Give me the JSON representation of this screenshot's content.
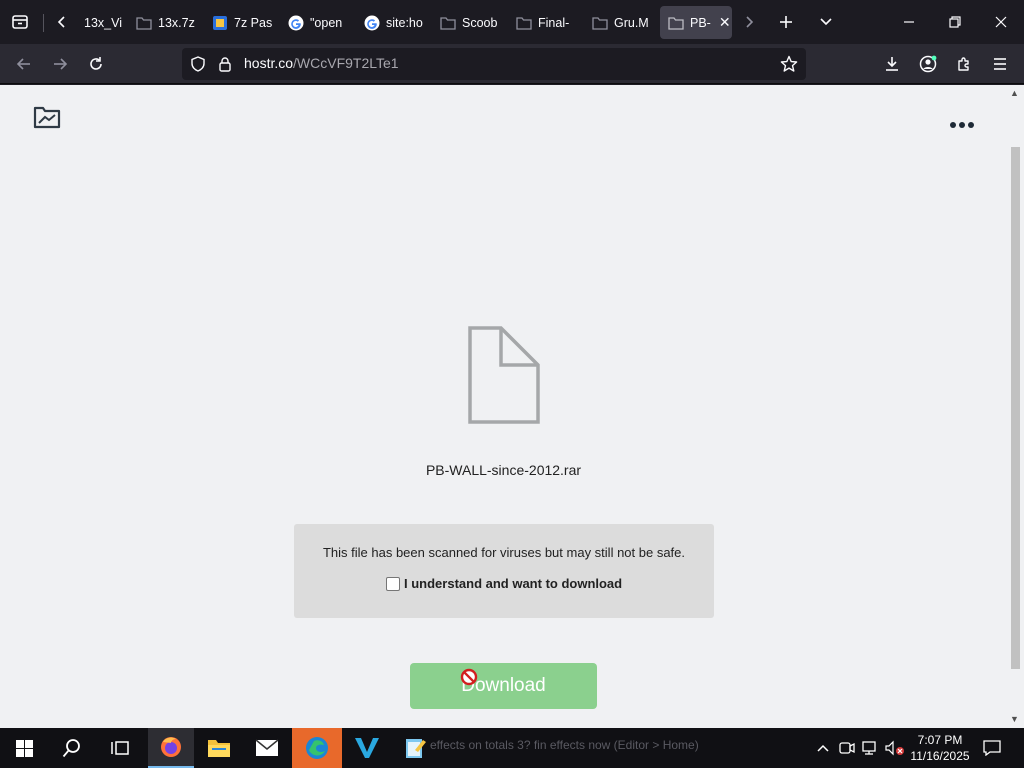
{
  "browser": {
    "tabs": [
      {
        "title": "13x_Vi",
        "favicon": "folder-icon",
        "active": false
      },
      {
        "title": "13x.7z",
        "favicon": "folder-icon",
        "active": false
      },
      {
        "title": "7z Pas",
        "favicon": "doc-icon",
        "active": false
      },
      {
        "title": "\"open",
        "favicon": "google-icon",
        "active": false
      },
      {
        "title": "site:ho",
        "favicon": "google-icon",
        "active": false
      },
      {
        "title": "Scoob",
        "favicon": "folder-icon",
        "active": false
      },
      {
        "title": "Final-",
        "favicon": "folder-icon",
        "active": false
      },
      {
        "title": "Gru.M",
        "favicon": "folder-icon",
        "active": false
      },
      {
        "title": "PB-",
        "favicon": "folder-icon",
        "active": true
      }
    ],
    "url_host": "hostr.co",
    "url_path": "/WCcVF9T2LTe1"
  },
  "page": {
    "filename": "PB-WALL-since-2012.rar",
    "warning_text": "This file has been scanned for viruses but may still not be safe.",
    "agree_label": "I understand and want to download",
    "agree_checked": false,
    "download_label": "Download"
  },
  "taskbar": {
    "ghost_text": "effects on totals 3? fin effects now (Editor > Home)",
    "time": "7:07 PM",
    "date": "11/16/2025"
  },
  "colors": {
    "tab_bg": "#1c1b22",
    "toolbar_bg": "#2b2a33",
    "page_bg": "#f0f1f3",
    "download_button": "#8bd08e",
    "warning_box": "#dcdcdc"
  }
}
